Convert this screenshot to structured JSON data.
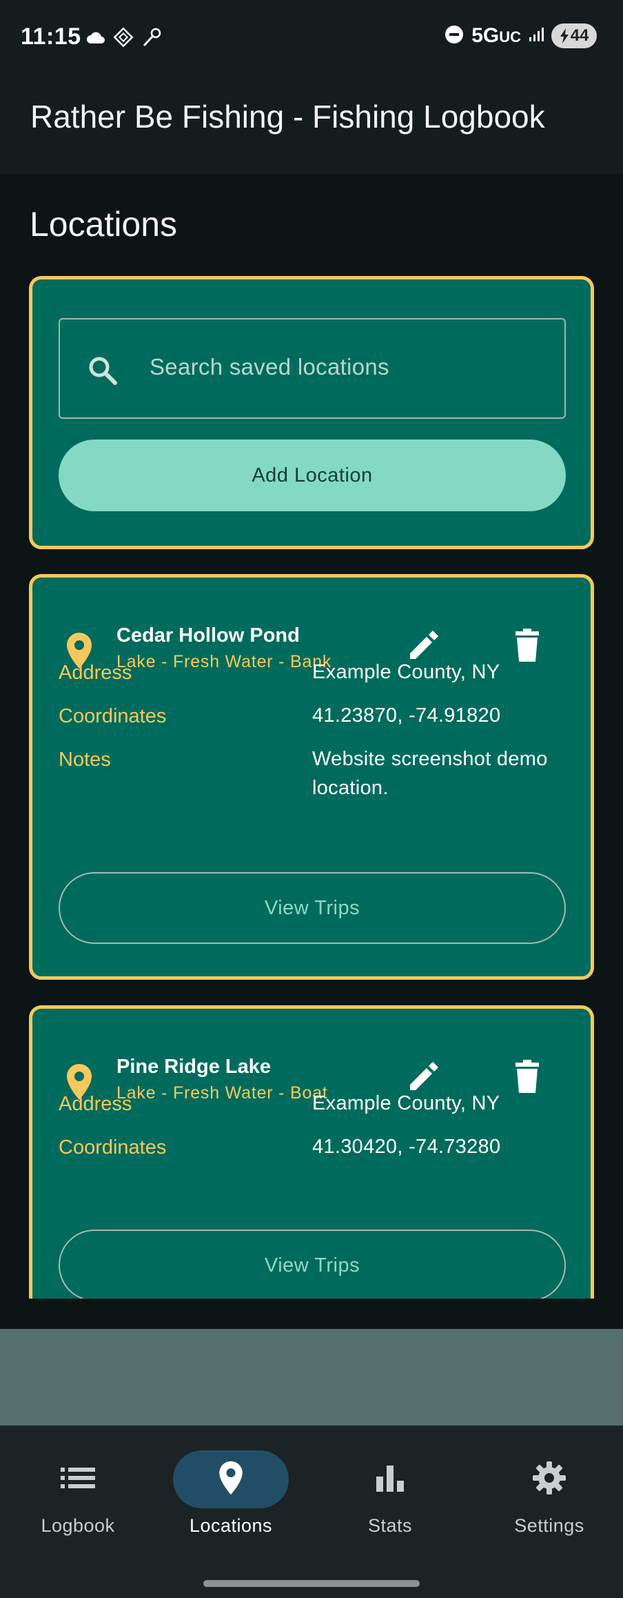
{
  "status_bar": {
    "time": "11:15",
    "network": "5G",
    "network_sub": "UC",
    "battery": "44",
    "icons_left": [
      "cloud-icon",
      "vpn-icon",
      "tool-icon"
    ],
    "icons_right": [
      "dnd-icon",
      "signal-icon",
      "battery-icon"
    ]
  },
  "app_bar": {
    "title": "Rather Be Fishing - Fishing Logbook"
  },
  "page": {
    "title": "Locations"
  },
  "search": {
    "placeholder": "Search saved locations",
    "add_label": "Add Location"
  },
  "locations": [
    {
      "name": "Cedar Hollow Pond",
      "subtitle": "Lake - Fresh Water - Bank",
      "fields": [
        {
          "label": "Address",
          "value": "Example County, NY"
        },
        {
          "label": "Coordinates",
          "value": "41.23870, -74.91820"
        },
        {
          "label": "Notes",
          "value": "Website screenshot demo location."
        }
      ],
      "trips_label": "View Trips"
    },
    {
      "name": "Pine Ridge Lake",
      "subtitle": "Lake - Fresh Water - Boat",
      "fields": [
        {
          "label": "Address",
          "value": "Example County, NY"
        },
        {
          "label": "Coordinates",
          "value": "41.30420, -74.73280"
        }
      ],
      "trips_label": "View Trips"
    }
  ],
  "bottom_nav": {
    "active": "Locations",
    "items": [
      {
        "label": "Logbook",
        "icon": "list-icon"
      },
      {
        "label": "Locations",
        "icon": "location-pin-icon"
      },
      {
        "label": "Stats",
        "icon": "bar-chart-icon"
      },
      {
        "label": "Settings",
        "icon": "gear-icon"
      }
    ]
  },
  "colors": {
    "accent": "#f7c85e",
    "card": "#006b5c",
    "button": "#84d9c5",
    "nav_active": "#214e66"
  }
}
